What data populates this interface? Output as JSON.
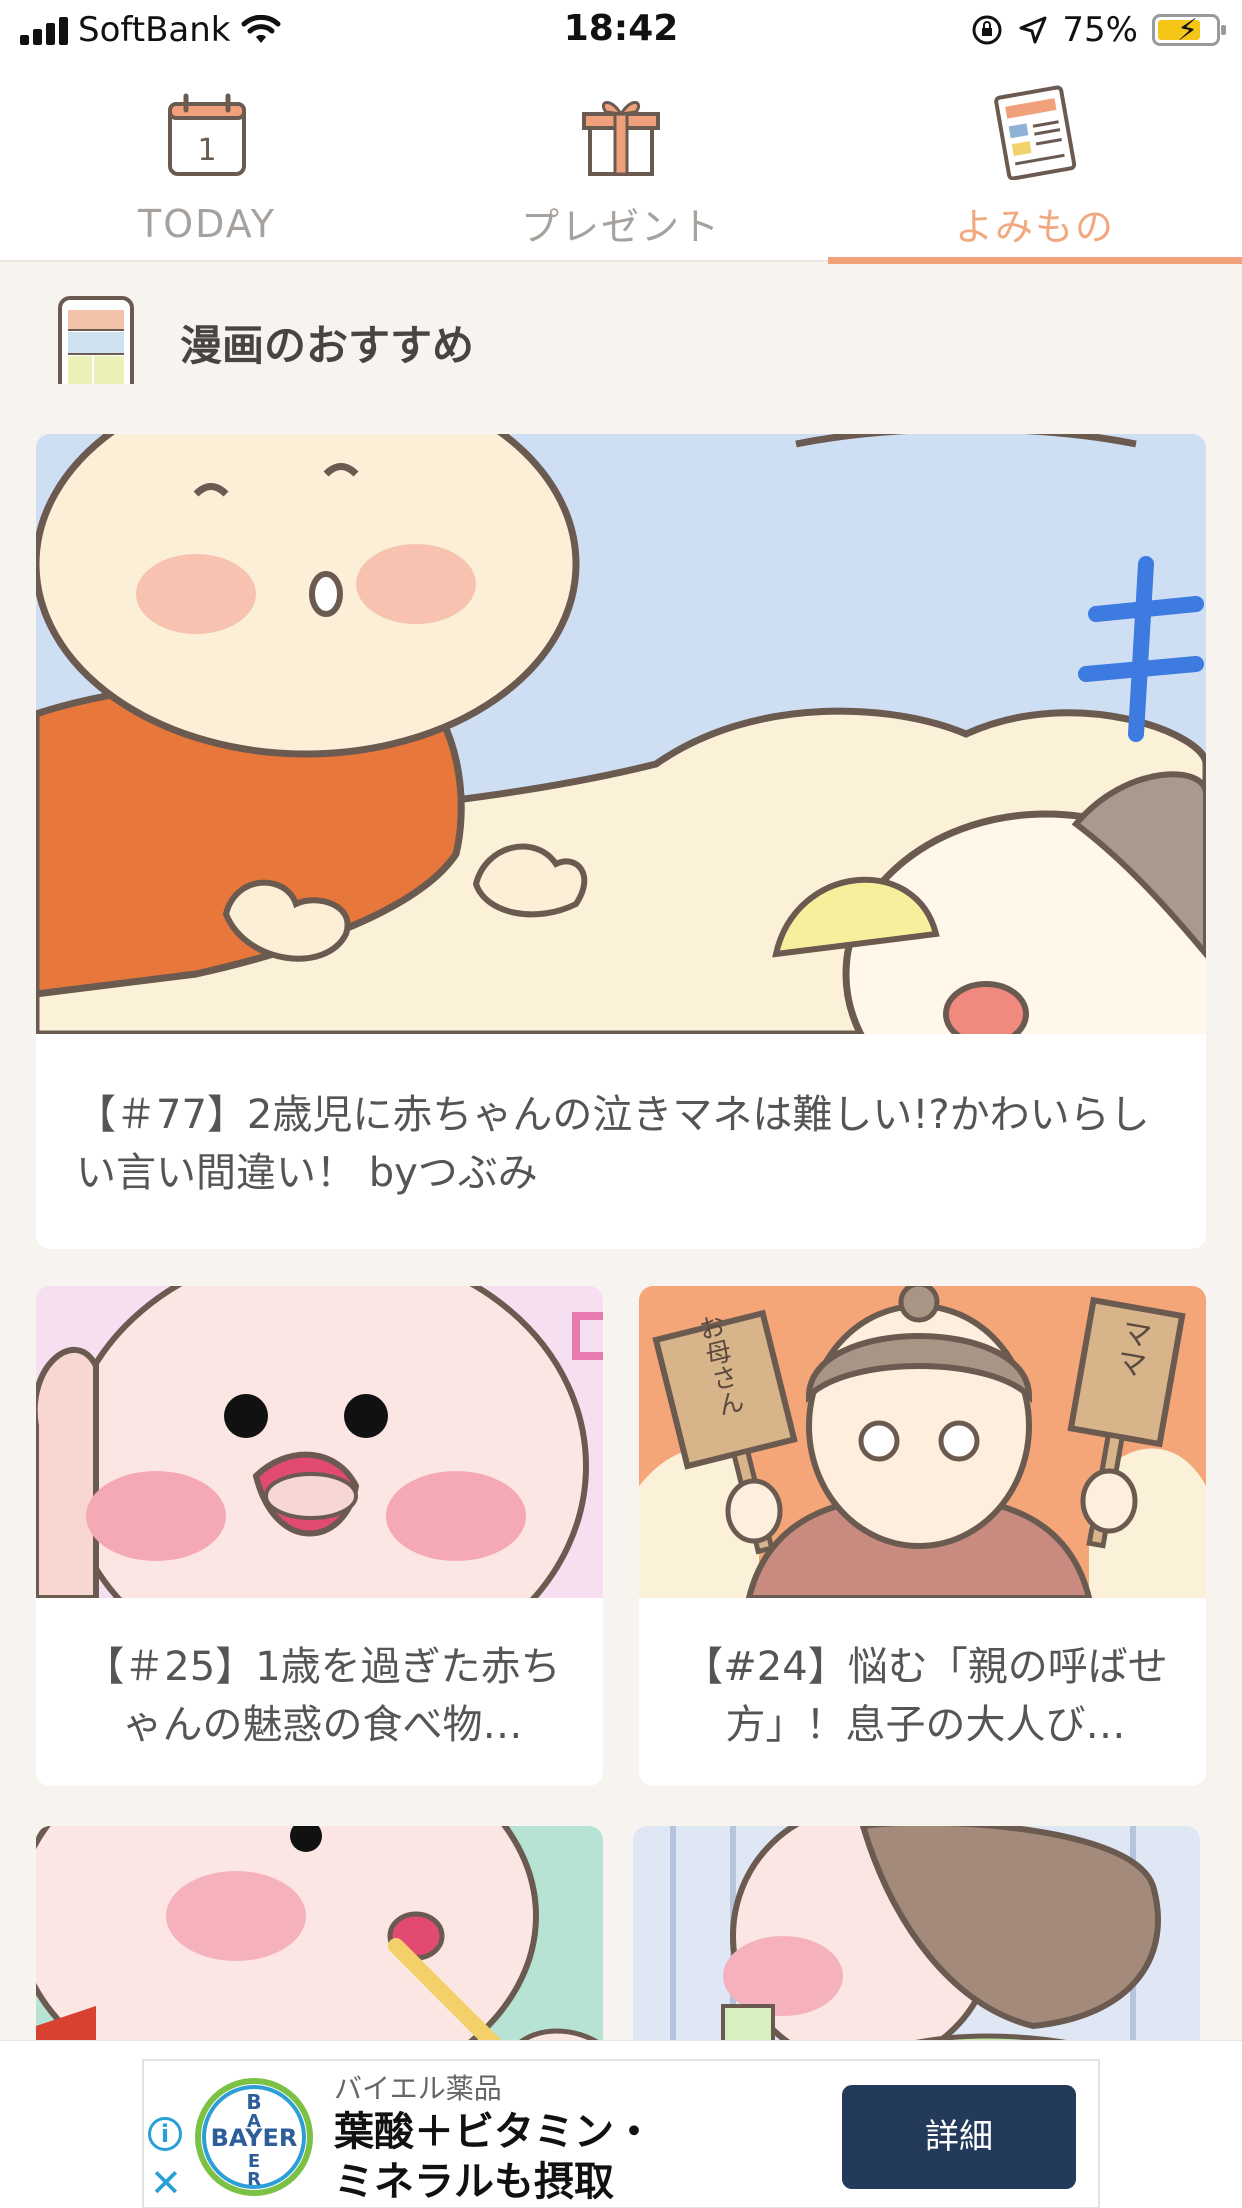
{
  "status_bar": {
    "carrier": "SoftBank",
    "time": "18:42",
    "battery_percent": "75%",
    "battery_level": 0.75,
    "icons": [
      "signal-icon",
      "wifi-icon",
      "orientation-lock-icon",
      "location-icon",
      "battery-charging-icon"
    ]
  },
  "tabs": [
    {
      "label": "TODAY",
      "icon": "calendar-icon",
      "calendar_day": "1",
      "active": false
    },
    {
      "label": "プレゼント",
      "icon": "gift-icon",
      "active": false
    },
    {
      "label": "よみもの",
      "icon": "newspaper-icon",
      "active": true
    }
  ],
  "section": {
    "title": "漫画のおすすめ",
    "icon": "manga-phone-icon"
  },
  "articles": [
    {
      "title": "【＃77】2歳児に赤ちゃんの泣きマネは難しい!?かわいらしい言い間違い！ byつぶみ"
    },
    {
      "title": "【＃25】1歳を過ぎた赤ちゃんの魅惑の食べ物…"
    },
    {
      "title": "【#24】悩む「親の呼ばせ方」！息子の大人び…"
    },
    {
      "title": ""
    },
    {
      "title": ""
    }
  ],
  "thumbnail_texts": {
    "article2_sign_left": "お母さん",
    "article2_sign_right": "ママ"
  },
  "ad": {
    "brand": "バイエル薬品",
    "headline_line1": "葉酸＋ビタミン・",
    "headline_line2": "ミネラルも摂取",
    "cta": "詳細",
    "logo_text": "BAYER"
  },
  "colors": {
    "accent": "#f2a27a",
    "background": "#f7f4f0",
    "ad_button": "#233a5a"
  }
}
